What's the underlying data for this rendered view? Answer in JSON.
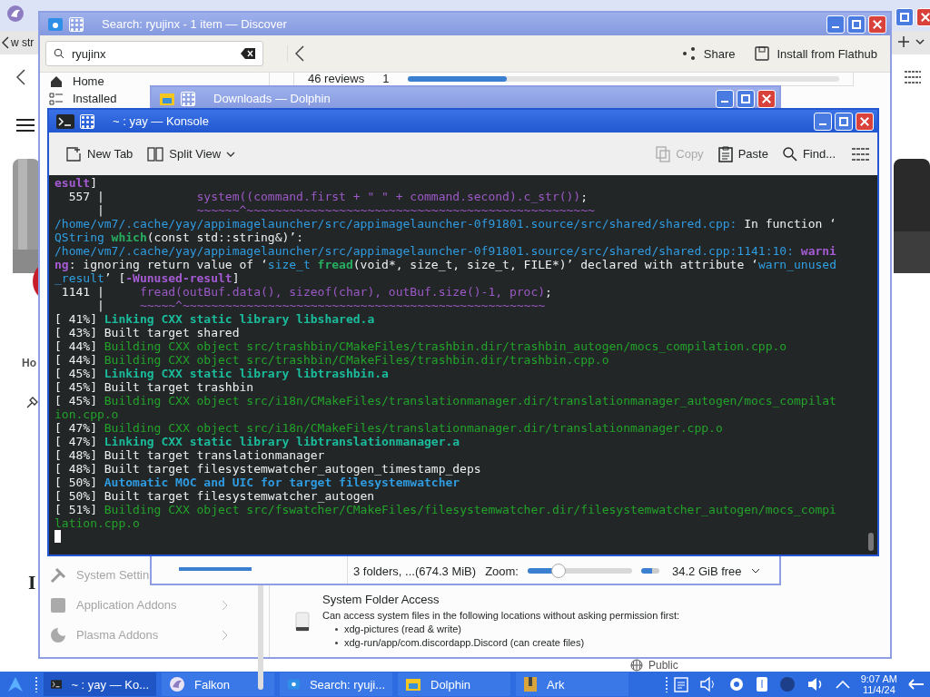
{
  "browser": {
    "tab_title": "w str",
    "side_heading": "Ho",
    "heading_letter": "I",
    "link": "Public"
  },
  "discover": {
    "title": "Search: ryujinx - 1 item — Discover",
    "search": {
      "value": "ryujinx"
    },
    "actions": [
      {
        "label": "Share",
        "kind": "share"
      },
      {
        "label": "Install from Flathub",
        "kind": "install"
      }
    ],
    "sidebar_top": [
      {
        "label": "Home",
        "kind": "home"
      },
      {
        "label": "Installed",
        "kind": "installed"
      }
    ],
    "sidebar_bottom": [
      {
        "label": "System Settin",
        "kind": "settings",
        "disabled": true,
        "chevron": false
      },
      {
        "label": "Application Addons",
        "kind": "addons",
        "disabled": true,
        "chevron": true
      },
      {
        "label": "Plasma Addons",
        "kind": "plasma",
        "disabled": true,
        "chevron": true
      }
    ],
    "reviews": {
      "count": "46 reviews",
      "star": "1",
      "level": 0.23
    },
    "permission": {
      "title": "System Folder Access",
      "description": "Can access system files in the following locations without asking permission first:",
      "items": [
        "xdg-pictures (read & write)",
        "xdg-run/app/com.discordapp.Discord (can create files)"
      ]
    }
  },
  "dolphin": {
    "title": "Downloads — Dolphin",
    "status": "3 folders, ...(674.3 MiB)",
    "zoom_label": "Zoom:",
    "zoom": {
      "level": 0.3
    },
    "free_space": "34.2 GiB free"
  },
  "konsole": {
    "title": "~ : yay — Konsole",
    "left_actions": [
      {
        "label": "New Tab",
        "kind": "new-tab",
        "dropdown": false
      },
      {
        "label": "Split View",
        "kind": "split",
        "dropdown": true
      }
    ],
    "right_actions": [
      {
        "label": "Copy",
        "kind": "copy",
        "disabled": true
      },
      {
        "label": "Paste",
        "kind": "paste",
        "disabled": false
      },
      {
        "label": "Find...",
        "kind": "find",
        "disabled": false
      }
    ],
    "lines": [
      [
        {
          "kind": "warn",
          "text": "esult"
        },
        {
          "kind": "plain",
          "text": "]"
        }
      ],
      [
        {
          "kind": "plain",
          "text": "  557 |             "
        },
        {
          "kind": "code",
          "text": "system((command.first + \" \" + command.second).c_str())"
        },
        {
          "kind": "plain",
          "text": ";"
        }
      ],
      [
        {
          "kind": "plain",
          "text": "      |             "
        },
        {
          "kind": "code",
          "text": "~~~~~~^~~~~~~~~~~~~~~~~~~~~~~~~~~~~~~~~~~~~~~~~~~~~~~~~~"
        }
      ],
      [
        {
          "kind": "path",
          "text": "/home/vm7/.cache/yay/appimagelauncher/src/appimagelauncher-0f91801.source/src/shared/shared.cpp:"
        },
        {
          "kind": "plain",
          "text": " In function ‘"
        }
      ],
      [
        {
          "kind": "type",
          "text": "QString"
        },
        {
          "kind": "func",
          "text": " which"
        },
        {
          "kind": "plain",
          "text": "(const std::string&)’:"
        }
      ],
      [
        {
          "kind": "path",
          "text": "/home/vm7/.cache/yay/appimagelauncher/src/appimagelauncher-0f91801.source/src/shared/shared.cpp:1141:10:"
        },
        {
          "kind": "warn",
          "text": " warni"
        }
      ],
      [
        {
          "kind": "warn",
          "text": "ng"
        },
        {
          "kind": "plain",
          "text": ": ignoring return value of ‘"
        },
        {
          "kind": "type",
          "text": "size_t"
        },
        {
          "kind": "func",
          "text": " fread"
        },
        {
          "kind": "plain",
          "text": "(void*, size_t, size_t, FILE*)’ declared with attribute ‘"
        },
        {
          "kind": "type",
          "text": "warn_unused"
        }
      ],
      [
        {
          "kind": "type",
          "text": "_result"
        },
        {
          "kind": "plain",
          "text": "’ ["
        },
        {
          "kind": "warn",
          "text": "-Wunused-result"
        },
        {
          "kind": "plain",
          "text": "]"
        }
      ],
      [
        {
          "kind": "plain",
          "text": " 1141 |     "
        },
        {
          "kind": "code",
          "text": "fread(outBuf.data(), sizeof(char), outBuf.size()-1, proc)"
        },
        {
          "kind": "plain",
          "text": ";"
        }
      ],
      [
        {
          "kind": "plain",
          "text": "      |     "
        },
        {
          "kind": "code",
          "text": "~~~~~^~~~~~~~~~~~~~~~~~~~~~~~~~~~~~~~~~~~~~~~~~~~~~~~~~~~"
        }
      ],
      [
        {
          "kind": "plain",
          "text": "[ 41%] "
        },
        {
          "kind": "link",
          "text": "Linking CXX static library libshared.a"
        }
      ],
      [
        {
          "kind": "plain",
          "text": "[ 43%] Built target shared"
        }
      ],
      [
        {
          "kind": "plain",
          "text": "[ 44%] "
        },
        {
          "kind": "build",
          "text": "Building CXX object src/trashbin/CMakeFiles/trashbin.dir/trashbin_autogen/mocs_compilation.cpp.o"
        }
      ],
      [
        {
          "kind": "plain",
          "text": "[ 44%] "
        },
        {
          "kind": "build",
          "text": "Building CXX object src/trashbin/CMakeFiles/trashbin.dir/trashbin.cpp.o"
        }
      ],
      [
        {
          "kind": "plain",
          "text": "[ 45%] "
        },
        {
          "kind": "link",
          "text": "Linking CXX static library libtrashbin.a"
        }
      ],
      [
        {
          "kind": "plain",
          "text": "[ 45%] Built target trashbin"
        }
      ],
      [
        {
          "kind": "plain",
          "text": "[ 45%] "
        },
        {
          "kind": "build",
          "text": "Building CXX object src/i18n/CMakeFiles/translationmanager.dir/translationmanager_autogen/mocs_compilat"
        }
      ],
      [
        {
          "kind": "build",
          "text": "ion.cpp.o"
        }
      ],
      [
        {
          "kind": "plain",
          "text": "[ 47%] "
        },
        {
          "kind": "build",
          "text": "Building CXX object src/i18n/CMakeFiles/translationmanager.dir/translationmanager.cpp.o"
        }
      ],
      [
        {
          "kind": "plain",
          "text": "[ 47%] "
        },
        {
          "kind": "link",
          "text": "Linking CXX static library libtranslationmanager.a"
        }
      ],
      [
        {
          "kind": "plain",
          "text": "[ 48%] Built target translationmanager"
        }
      ],
      [
        {
          "kind": "plain",
          "text": "[ 48%] Built target filesystemwatcher_autogen_timestamp_deps"
        }
      ],
      [
        {
          "kind": "plain",
          "text": "[ 50%] "
        },
        {
          "kind": "auto",
          "text": "Automatic MOC and UIC for target filesystemwatcher"
        }
      ],
      [
        {
          "kind": "plain",
          "text": "[ 50%] Built target filesystemwatcher_autogen"
        }
      ],
      [
        {
          "kind": "plain",
          "text": "[ 51%] "
        },
        {
          "kind": "build",
          "text": "Building CXX object src/fswatcher/CMakeFiles/filesystemwatcher.dir/filesystemwatcher_autogen/mocs_compi"
        }
      ],
      [
        {
          "kind": "build",
          "text": "lation.cpp.o"
        }
      ]
    ],
    "cursor": true
  },
  "taskbar": {
    "tasks": [
      {
        "label": "~ : yay — Ko...",
        "kind": "terminal",
        "selected": true
      },
      {
        "label": "Falkon",
        "kind": "falkon",
        "selected": false
      },
      {
        "label": "Search: ryuji...",
        "kind": "discover",
        "selected": false
      },
      {
        "label": "Dolphin",
        "kind": "dolphin",
        "selected": false
      },
      {
        "label": "Ark",
        "kind": "ark",
        "selected": false
      }
    ],
    "time": "9:07 AM",
    "date": "11/4/24"
  }
}
